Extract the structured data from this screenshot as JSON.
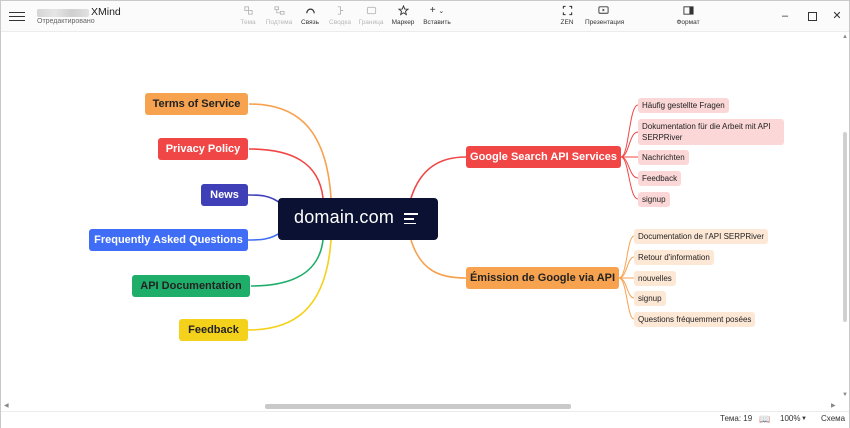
{
  "titlebar": {
    "app_name": "XMind",
    "doc_status": "Отредактировано",
    "tools": [
      {
        "label": "Тема",
        "icon": "topic-icon",
        "enabled": false
      },
      {
        "label": "Подтема",
        "icon": "subtopic-icon",
        "enabled": false
      },
      {
        "label": "Связь",
        "icon": "relationship-icon",
        "enabled": true
      },
      {
        "label": "Сводка",
        "icon": "summary-icon",
        "enabled": false
      },
      {
        "label": "Граница",
        "icon": "boundary-icon",
        "enabled": false
      },
      {
        "label": "Маркер",
        "icon": "star-icon",
        "enabled": true
      },
      {
        "label": "Вставить",
        "icon": "plus-icon",
        "enabled": true
      }
    ],
    "zen_label": "ZEN",
    "presentation_label": "Презентация",
    "format_label": "Формат"
  },
  "mindmap": {
    "central": "domain.com",
    "left_topics": [
      {
        "label": "Terms of Service",
        "color": "#f7a24f",
        "text_color": "#222222"
      },
      {
        "label": "Privacy Policy",
        "color": "#f04646",
        "text_color": "#ffffff"
      },
      {
        "label": "News",
        "color": "#3f3fb8",
        "text_color": "#ffffff"
      },
      {
        "label": "Frequently Asked Questions",
        "color": "#3f6df6",
        "text_color": "#ffffff"
      },
      {
        "label": "API Documentation",
        "color": "#1fae6a",
        "text_color": "#222222"
      },
      {
        "label": "Feedback",
        "color": "#f4d21c",
        "text_color": "#222222"
      }
    ],
    "right_topics": [
      {
        "label": "Google Search API Services",
        "color": "#f04646",
        "text_color": "#ffffff",
        "subtopics": [
          "Häufig gestellte Fragen",
          "Dokumentation für die Arbeit mit API SERPRiver",
          "Nachrichten",
          "Feedback",
          "signup"
        ]
      },
      {
        "label": "Émission de Google via API",
        "color": "#f7a24f",
        "text_color": "#222222",
        "subtopics": [
          "Documentation de l'API SERPRiver",
          "Retour d'information",
          "nouvelles",
          "signup",
          "Questions fréquemment posées"
        ]
      }
    ]
  },
  "statusbar": {
    "topics_count": "Тема: 19",
    "zoom": "100%",
    "view_label": "Схема"
  }
}
